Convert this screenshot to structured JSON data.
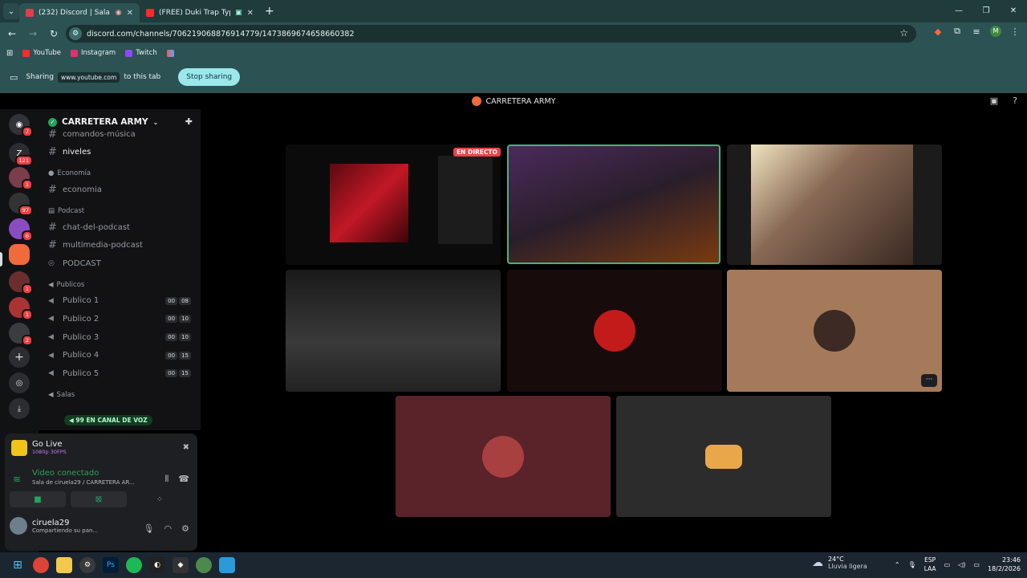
{
  "browser": {
    "tabs": [
      {
        "badge": "232",
        "title": "(232) Discord | Sala de...",
        "active": true
      },
      {
        "title": "(FREE) Duki Trap Type Beat",
        "active": false
      }
    ],
    "url": "discord.com/channels/706219068876914779/1473869674658660382",
    "bookmarks": [
      "YouTube",
      "Instagram",
      "Twitch"
    ],
    "share": {
      "label_sharing": "Sharing",
      "site": "www.youtube.com",
      "label_to_tab": "to this tab",
      "stop": "Stop sharing"
    }
  },
  "discord": {
    "window_title": "CARRETERA ARMY",
    "server_name": "CARRETERA ARMY",
    "channels": [
      {
        "type": "text",
        "name": "comandos-música"
      },
      {
        "type": "text",
        "name": "niveles",
        "bright": true
      },
      {
        "type": "category",
        "name": "Economía"
      },
      {
        "type": "text",
        "name": "economia"
      },
      {
        "type": "category",
        "name": "Podcast"
      },
      {
        "type": "text",
        "name": "chat-del-podcast"
      },
      {
        "type": "text",
        "name": "multimedia-podcast"
      },
      {
        "type": "stage",
        "name": "PODCAST"
      },
      {
        "type": "category",
        "name": "Publicos"
      },
      {
        "type": "voice",
        "name": "Publico 1",
        "count": [
          "00",
          "08"
        ]
      },
      {
        "type": "voice",
        "name": "Publico 2",
        "count": [
          "00",
          "10"
        ]
      },
      {
        "type": "voice",
        "name": "Publico 3",
        "count": [
          "00",
          "10"
        ]
      },
      {
        "type": "voice",
        "name": "Publico 4",
        "count": [
          "00",
          "15"
        ]
      },
      {
        "type": "voice",
        "name": "Publico 5",
        "count": [
          "00",
          "15"
        ]
      },
      {
        "type": "category",
        "name": "Salas"
      }
    ],
    "voice_chip": "99 EN CANAL DE VOZ",
    "server_badges": [
      "7",
      "121",
      "1",
      "97",
      "6",
      "1",
      "1",
      "2"
    ],
    "go_live": {
      "title": "Go Live",
      "quality": "1080p 30FPS"
    },
    "voice_connected": {
      "status": "Video conectado",
      "channel": "Sala de ciruela29 / CARRETERA AR..."
    },
    "user": {
      "name": "ciruela29",
      "status": "Compartiendo su pan..."
    },
    "live_badge": "EN DIRECTO"
  },
  "taskbar": {
    "weather_temp": "24°C",
    "weather_desc": "Lluvia ligera",
    "lang1": "ESP",
    "lang2": "LAA",
    "time": "23:46",
    "date": "18/2/2026"
  },
  "colors": {
    "chrome": "#2c5253",
    "discord_bg": "#000000",
    "accent_green": "#23a55a",
    "share_button": "#9be7ea",
    "live_red": "#ed4245"
  }
}
